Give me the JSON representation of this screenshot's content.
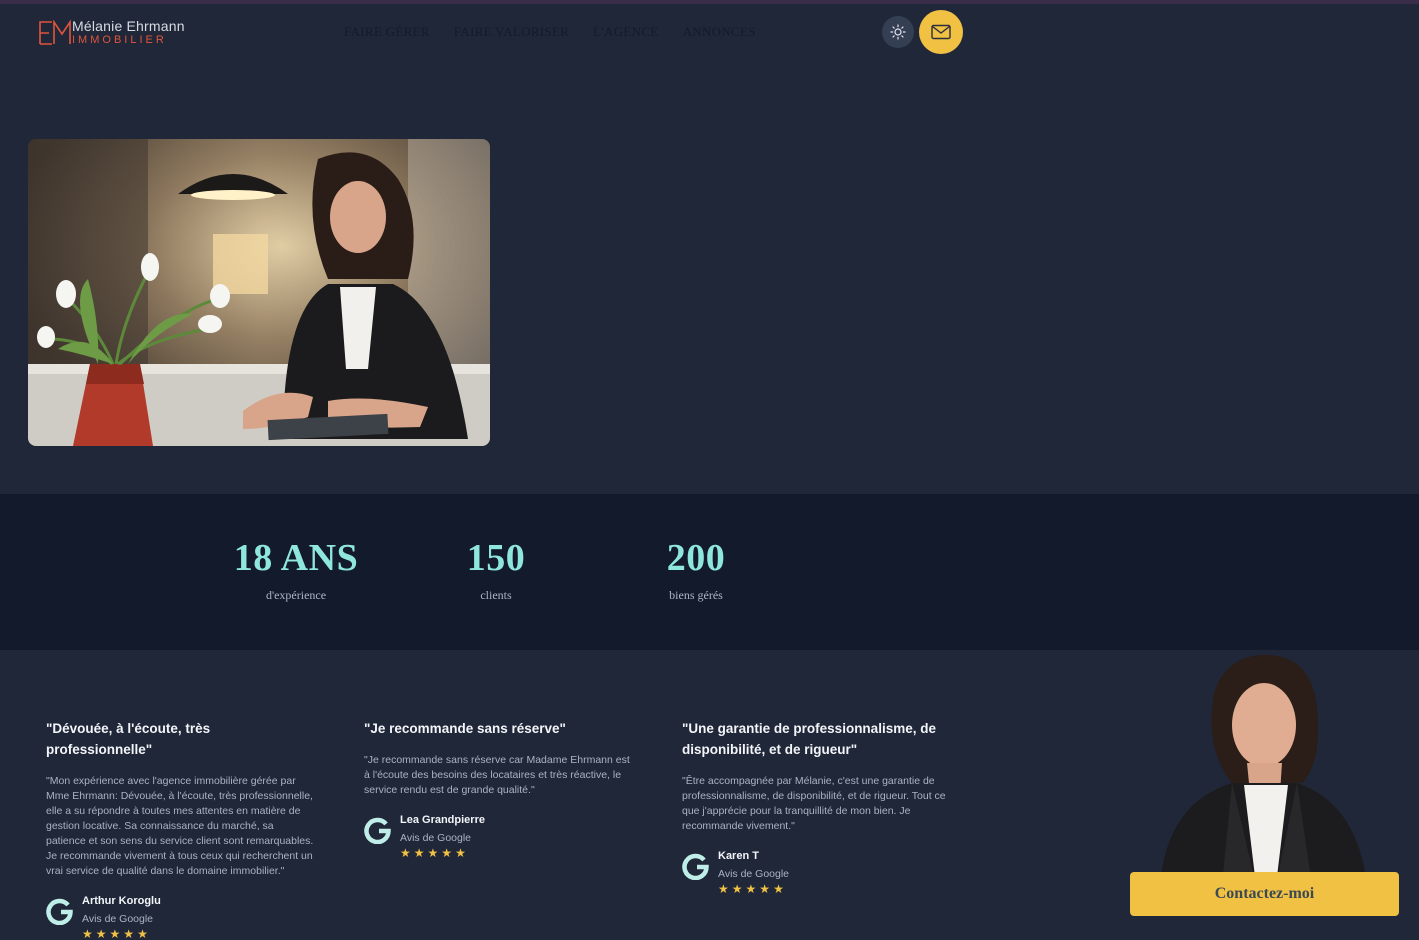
{
  "header": {
    "logo": {
      "name": "Mélanie Ehrmann",
      "sub": "IMMOBILIER"
    },
    "nav": [
      {
        "label": "FAIRE GÉRER"
      },
      {
        "label": "FAIRE VALORISER"
      },
      {
        "label": "L'AGENCE"
      },
      {
        "label": "ANNONCES"
      }
    ]
  },
  "stats": [
    {
      "value": "18 ANS",
      "label": "d'expérience"
    },
    {
      "value": "150",
      "label": "clients"
    },
    {
      "value": "200",
      "label": "biens gérés"
    }
  ],
  "reviews": [
    {
      "title": "\"Dévouée, à l'écoute, très professionnelle\"",
      "body": "\"Mon expérience avec l'agence immobilière gérée par Mme Ehrmann: Dévouée, à l'écoute, très professionnelle, elle a su répondre à toutes mes attentes en matière de gestion locative. Sa connaissance du marché, sa patience et son sens du service client sont remarquables. Je recommande vivement à tous ceux qui recherchent un vrai service de qualité dans le domaine immobilier.\"",
      "author": "Arthur Koroglu",
      "source": "Avis de Google",
      "stars": 5
    },
    {
      "title": "\"Je recommande sans réserve\"",
      "body": "\"Je recommande sans réserve car Madame Ehrmann est à l'écoute des besoins des locataires et très réactive, le service rendu est de grande qualité.\"",
      "author": "Lea Grandpierre",
      "source": "Avis de Google",
      "stars": 5
    },
    {
      "title": "\"Une garantie de professionnalisme, de disponibilité, et de rigueur\"",
      "body": "\"Être accompagnée par Mélanie, c'est une garantie de professionnalisme, de disponibilité, et de rigueur. Tout ce que j'apprécie pour la tranquillité de mon bien. Je recommande vivement.\"",
      "author": "Karen T",
      "source": "Avis de Google",
      "stars": 5
    }
  ],
  "cta": {
    "label": "Contactez-moi"
  },
  "colors": {
    "background": "#1f2739",
    "stats_band": "#121a2c",
    "accent_yellow": "#f1c143",
    "stat_teal": "#8fe6dc",
    "logo_red": "#e0553d"
  },
  "icons": {
    "theme": "sun-icon",
    "mail": "envelope-icon",
    "review_source": "google-g-icon",
    "rating": "star-icon"
  }
}
